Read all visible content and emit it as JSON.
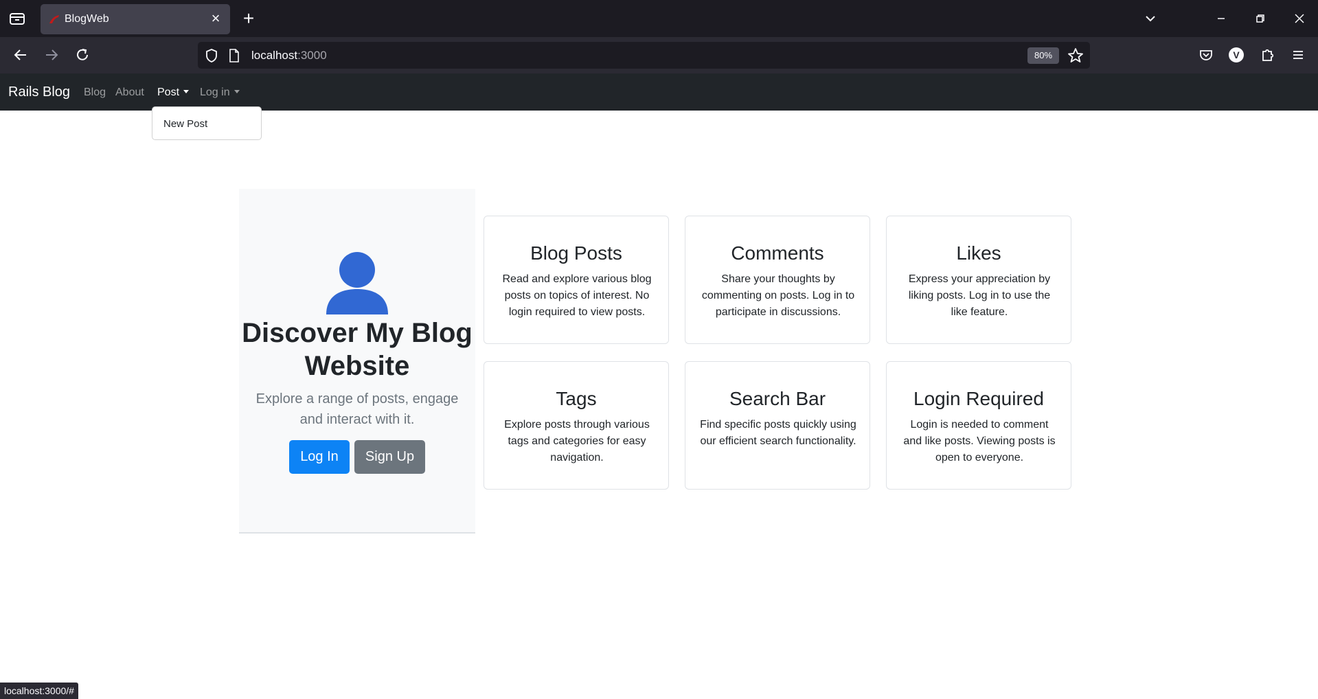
{
  "browser": {
    "tab_title": "BlogWeb",
    "url_host": "localhost",
    "url_port": ":3000",
    "zoom": "80%",
    "status_url": "localhost:3000/#"
  },
  "site": {
    "brand": "Rails Blog",
    "nav": {
      "blog": "Blog",
      "about": "About",
      "post": "Post",
      "login": "Log in"
    },
    "dropdown": {
      "new_post": "New Post"
    }
  },
  "hero": {
    "title": "Discover My Blog Website",
    "subtitle": "Explore a range of posts, engage and interact with it.",
    "login_button": "Log In",
    "signup_button": "Sign Up"
  },
  "cards": [
    {
      "title": "Blog Posts",
      "text": "Read and explore various blog posts on topics of interest. No login required to view posts."
    },
    {
      "title": "Comments",
      "text": "Share your thoughts by commenting on posts. Log in to participate in discussions."
    },
    {
      "title": "Likes",
      "text": "Express your appreciation by liking posts. Log in to use the like feature."
    },
    {
      "title": "Tags",
      "text": "Explore posts through various tags and categories for easy navigation."
    },
    {
      "title": "Search Bar",
      "text": "Find specific posts quickly using our efficient search functionality."
    },
    {
      "title": "Login Required",
      "text": "Login is needed to comment and like posts. Viewing posts is open to everyone."
    }
  ],
  "colors": {
    "primary": "#0d83f5",
    "secondary": "#6c757d",
    "avatar": "#3168d3",
    "navbar": "#212529"
  }
}
